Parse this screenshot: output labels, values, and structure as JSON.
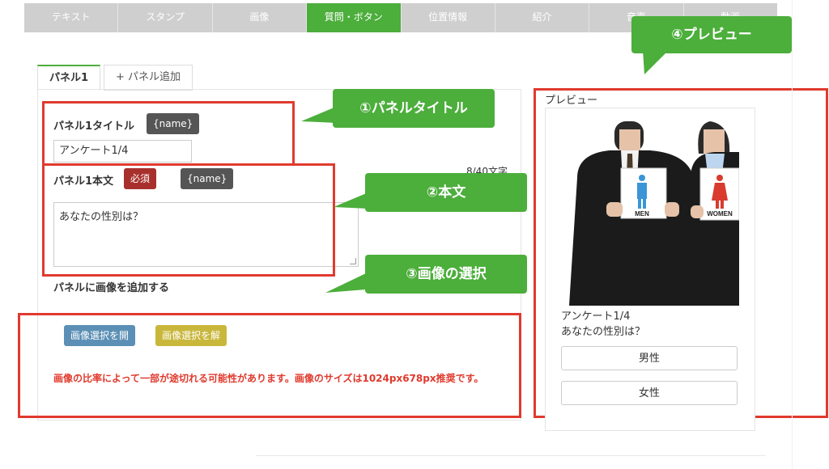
{
  "tabs": [
    "テキスト",
    "スタンプ",
    "画像",
    "質問・ボタン",
    "位置情報",
    "紹介",
    "音声",
    "動画"
  ],
  "panel_tabs": {
    "panel1": "パネル1",
    "add_panel": "+ パネル追加"
  },
  "title_field": {
    "label": "パネル1タイトル",
    "tag": "{name}",
    "value": "アンケート1/4"
  },
  "body_field": {
    "label": "パネル1本文",
    "required": "必須",
    "tag": "{name}",
    "value": "あなたの性別は？",
    "counter": "8/40文字"
  },
  "image_section": {
    "label": "パネルに画像を追加する",
    "open_button": "画像選択を開",
    "clear_button": "画像選択を解",
    "warning": "画像の比率によって一部が途切れる可能性があります。画像のサイズは1024px678px推奨です。"
  },
  "callouts": {
    "c1": "①パネルタイトル",
    "c2": "②本文",
    "c3": "③画像の選択",
    "c4": "④プレビュー"
  },
  "preview": {
    "heading": "プレビュー",
    "title": "アンケート1/4",
    "body": "あなたの性別は？",
    "choices": [
      "男性",
      "女性"
    ],
    "sign_men": "MEN",
    "sign_women": "WOMEN"
  },
  "colors": {
    "accent_green": "#4cae3b",
    "highlight_red": "#e03a2e",
    "required_red": "#a8302c"
  }
}
